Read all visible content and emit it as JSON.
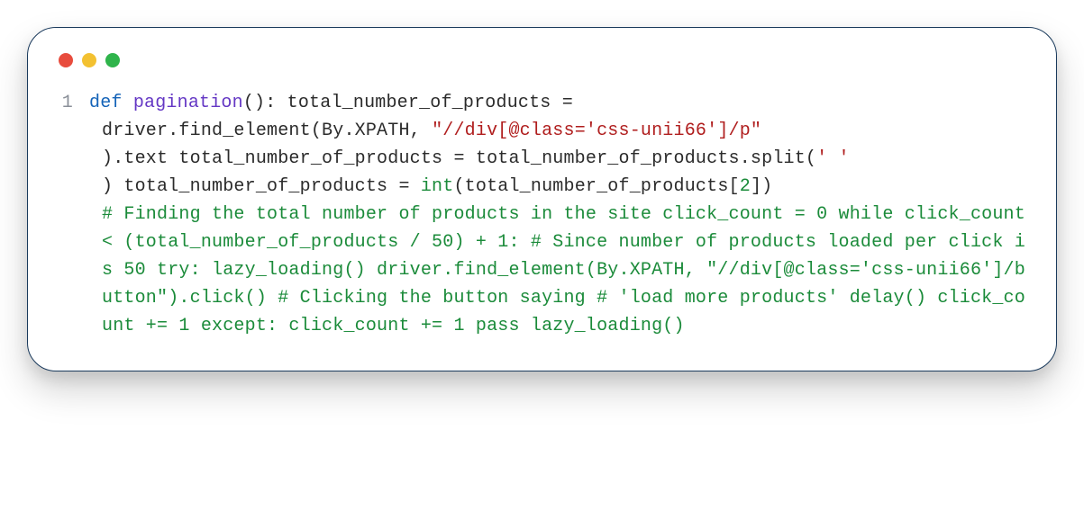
{
  "line_number": "1",
  "code": {
    "kw_def": "def",
    "fn_pagination": "pagination",
    "after_fn_open": "(): total_number_of_products =",
    "line2a": " driver.find_element(By.XPATH, ",
    "str_xpath1": "\"//div[@class='css-unii66']/p\"",
    "line3a": ").text total_number_of_products = total_number_of_products.split(",
    "str_space": "' '",
    "line4a": ") total_number_of_products = ",
    "int_kw": "int",
    "line4b": "(total_number_of_products[",
    "num2": "2",
    "line4c": "])",
    "comment_block": "# Finding the total number of products in the site click_count = 0 while click_count < (total_number_of_products / 50) + 1: # Since number of products loaded per click is 50 try: lazy_loading() driver.find_element(By.XPATH, \"//div[@class='css-unii66']/button\").click() # Clicking the button saying # 'load more products' delay() click_count += 1 except: click_count += 1 pass lazy_loading()"
  }
}
